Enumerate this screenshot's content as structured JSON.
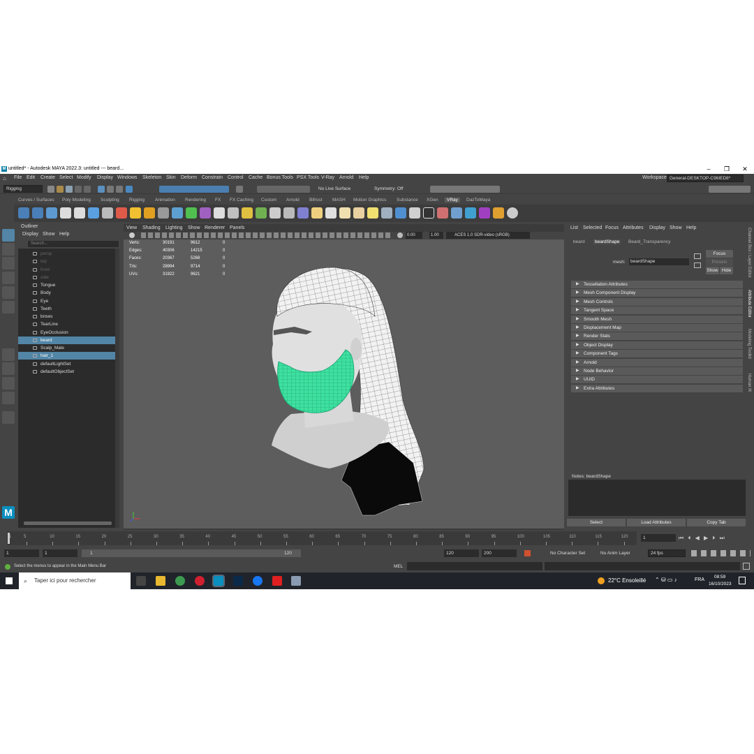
{
  "window": {
    "title": "untitled* - Autodesk MAYA 2022.3: untitled  ---  beard...",
    "minimize": "–",
    "restore": "❐",
    "close": "✕"
  },
  "menubar": [
    "File",
    "Edit",
    "Create",
    "Select",
    "Modify",
    "Display",
    "Windows",
    "Skeleton",
    "Skin",
    "Deform",
    "Constrain",
    "Control",
    "Cache",
    "Bonus Tools",
    "PSX Tools",
    "V-Ray",
    "Arnold",
    "Help"
  ],
  "workspace": {
    "label": "Workspace:",
    "value": "General-DESKTOP-C96IED8*"
  },
  "statusline": {
    "mode": "Rigging",
    "live_surface": "No Live Surface",
    "symmetry": "Symmetry: Off"
  },
  "shelf_tabs": [
    "Curves / Surfaces",
    "Poly Modeling",
    "Sculpting",
    "Rigging",
    "Animation",
    "Rendering",
    "FX",
    "FX Caching",
    "Custom",
    "Arnold",
    "Bifrost",
    "MASH",
    "Motion Graphics",
    "Substance",
    "XGen",
    "VRay",
    "DazToMaya"
  ],
  "shelf_active": "VRay",
  "outliner": {
    "title": "Outliner",
    "menu": [
      "Display",
      "Show",
      "Help"
    ],
    "search_placeholder": "Search...",
    "items": [
      {
        "label": "persp",
        "state": "dim"
      },
      {
        "label": "top",
        "state": "dim"
      },
      {
        "label": "front",
        "state": "dim"
      },
      {
        "label": "side",
        "state": "dim"
      },
      {
        "label": "Tongue",
        "state": ""
      },
      {
        "label": "Body",
        "state": ""
      },
      {
        "label": "Eye",
        "state": ""
      },
      {
        "label": "Teeth",
        "state": ""
      },
      {
        "label": "brows",
        "state": ""
      },
      {
        "label": "TearLine",
        "state": ""
      },
      {
        "label": "EyeOcclusion",
        "state": ""
      },
      {
        "label": "beard",
        "state": "sel"
      },
      {
        "label": "Scalp_Male",
        "state": ""
      },
      {
        "label": "hair_1",
        "state": "sel"
      },
      {
        "label": "defaultLightSet",
        "state": ""
      },
      {
        "label": "defaultObjectSet",
        "state": ""
      }
    ]
  },
  "viewport": {
    "menu": [
      "View",
      "Shading",
      "Lighting",
      "Show",
      "Renderer",
      "Panels"
    ],
    "exposure": "0.00",
    "gamma": "1.00",
    "colorspace": "ACES 1.0 SDR-video (sRGB)",
    "hud": [
      {
        "label": "Verts:",
        "a": "30191",
        "b": "9612",
        "c": "0"
      },
      {
        "label": "Edges:",
        "a": "40306",
        "b": "14215",
        "c": "0"
      },
      {
        "label": "Faces:",
        "a": "20367",
        "b": "5268",
        "c": "0"
      },
      {
        "label": "Tris:",
        "a": "28994",
        "b": "9714",
        "c": "0"
      },
      {
        "label": "UVs:",
        "a": "31922",
        "b": "9621",
        "c": "0"
      }
    ]
  },
  "attribute_editor": {
    "menu": [
      "List",
      "Selected",
      "Focus",
      "Attributes",
      "Display",
      "Show",
      "Help"
    ],
    "tabs": [
      "beard",
      "beardShape",
      "Beard_Transparency"
    ],
    "active_tab": "beardShape",
    "mesh_label": "mesh:",
    "mesh_value": "beardShape",
    "focus": "Focus",
    "presets": "Presets",
    "show": "Show",
    "hide": "Hide",
    "sections": [
      "Tessellation Attributes",
      "Mesh Component Display",
      "Mesh Controls",
      "Tangent Space",
      "Smooth Mesh",
      "Displacement Map",
      "Render Stats",
      "Object Display",
      "Component Tags",
      "Arnold",
      "Node Behavior",
      "UUID",
      "Extra Attributes"
    ],
    "notes_label": "Notes:  beardShape",
    "buttons": [
      "Select",
      "Load Attributes",
      "Copy Tab"
    ]
  },
  "side_tabs": [
    "Channel Box / Layer Editor",
    "Attribute Editor",
    "Modeling Toolkit",
    "Human IK"
  ],
  "timeline": {
    "ticks": [
      "5",
      "10",
      "15",
      "20",
      "25",
      "30",
      "35",
      "40",
      "45",
      "50",
      "55",
      "60",
      "65",
      "70",
      "75",
      "80",
      "85",
      "90",
      "95",
      "100",
      "105",
      "110",
      "115",
      "120"
    ],
    "start_mark": "1",
    "current_frame": "1"
  },
  "range": {
    "start": "1",
    "start2": "1",
    "slider_start": "1",
    "slider_end": "120",
    "end": "120",
    "end2": "200",
    "char_set": "No Character Set",
    "anim_layer": "No Anim Layer",
    "fps": "24 fps"
  },
  "command": {
    "lang": "MEL",
    "help": "Select the menus to appear in the Main Menu Bar"
  },
  "taskbar": {
    "search": "Taper ici pour rechercher",
    "weather": "22°C  Ensoleillé",
    "lang": "FRA",
    "time": "08:59",
    "date": "16/10/2023"
  }
}
